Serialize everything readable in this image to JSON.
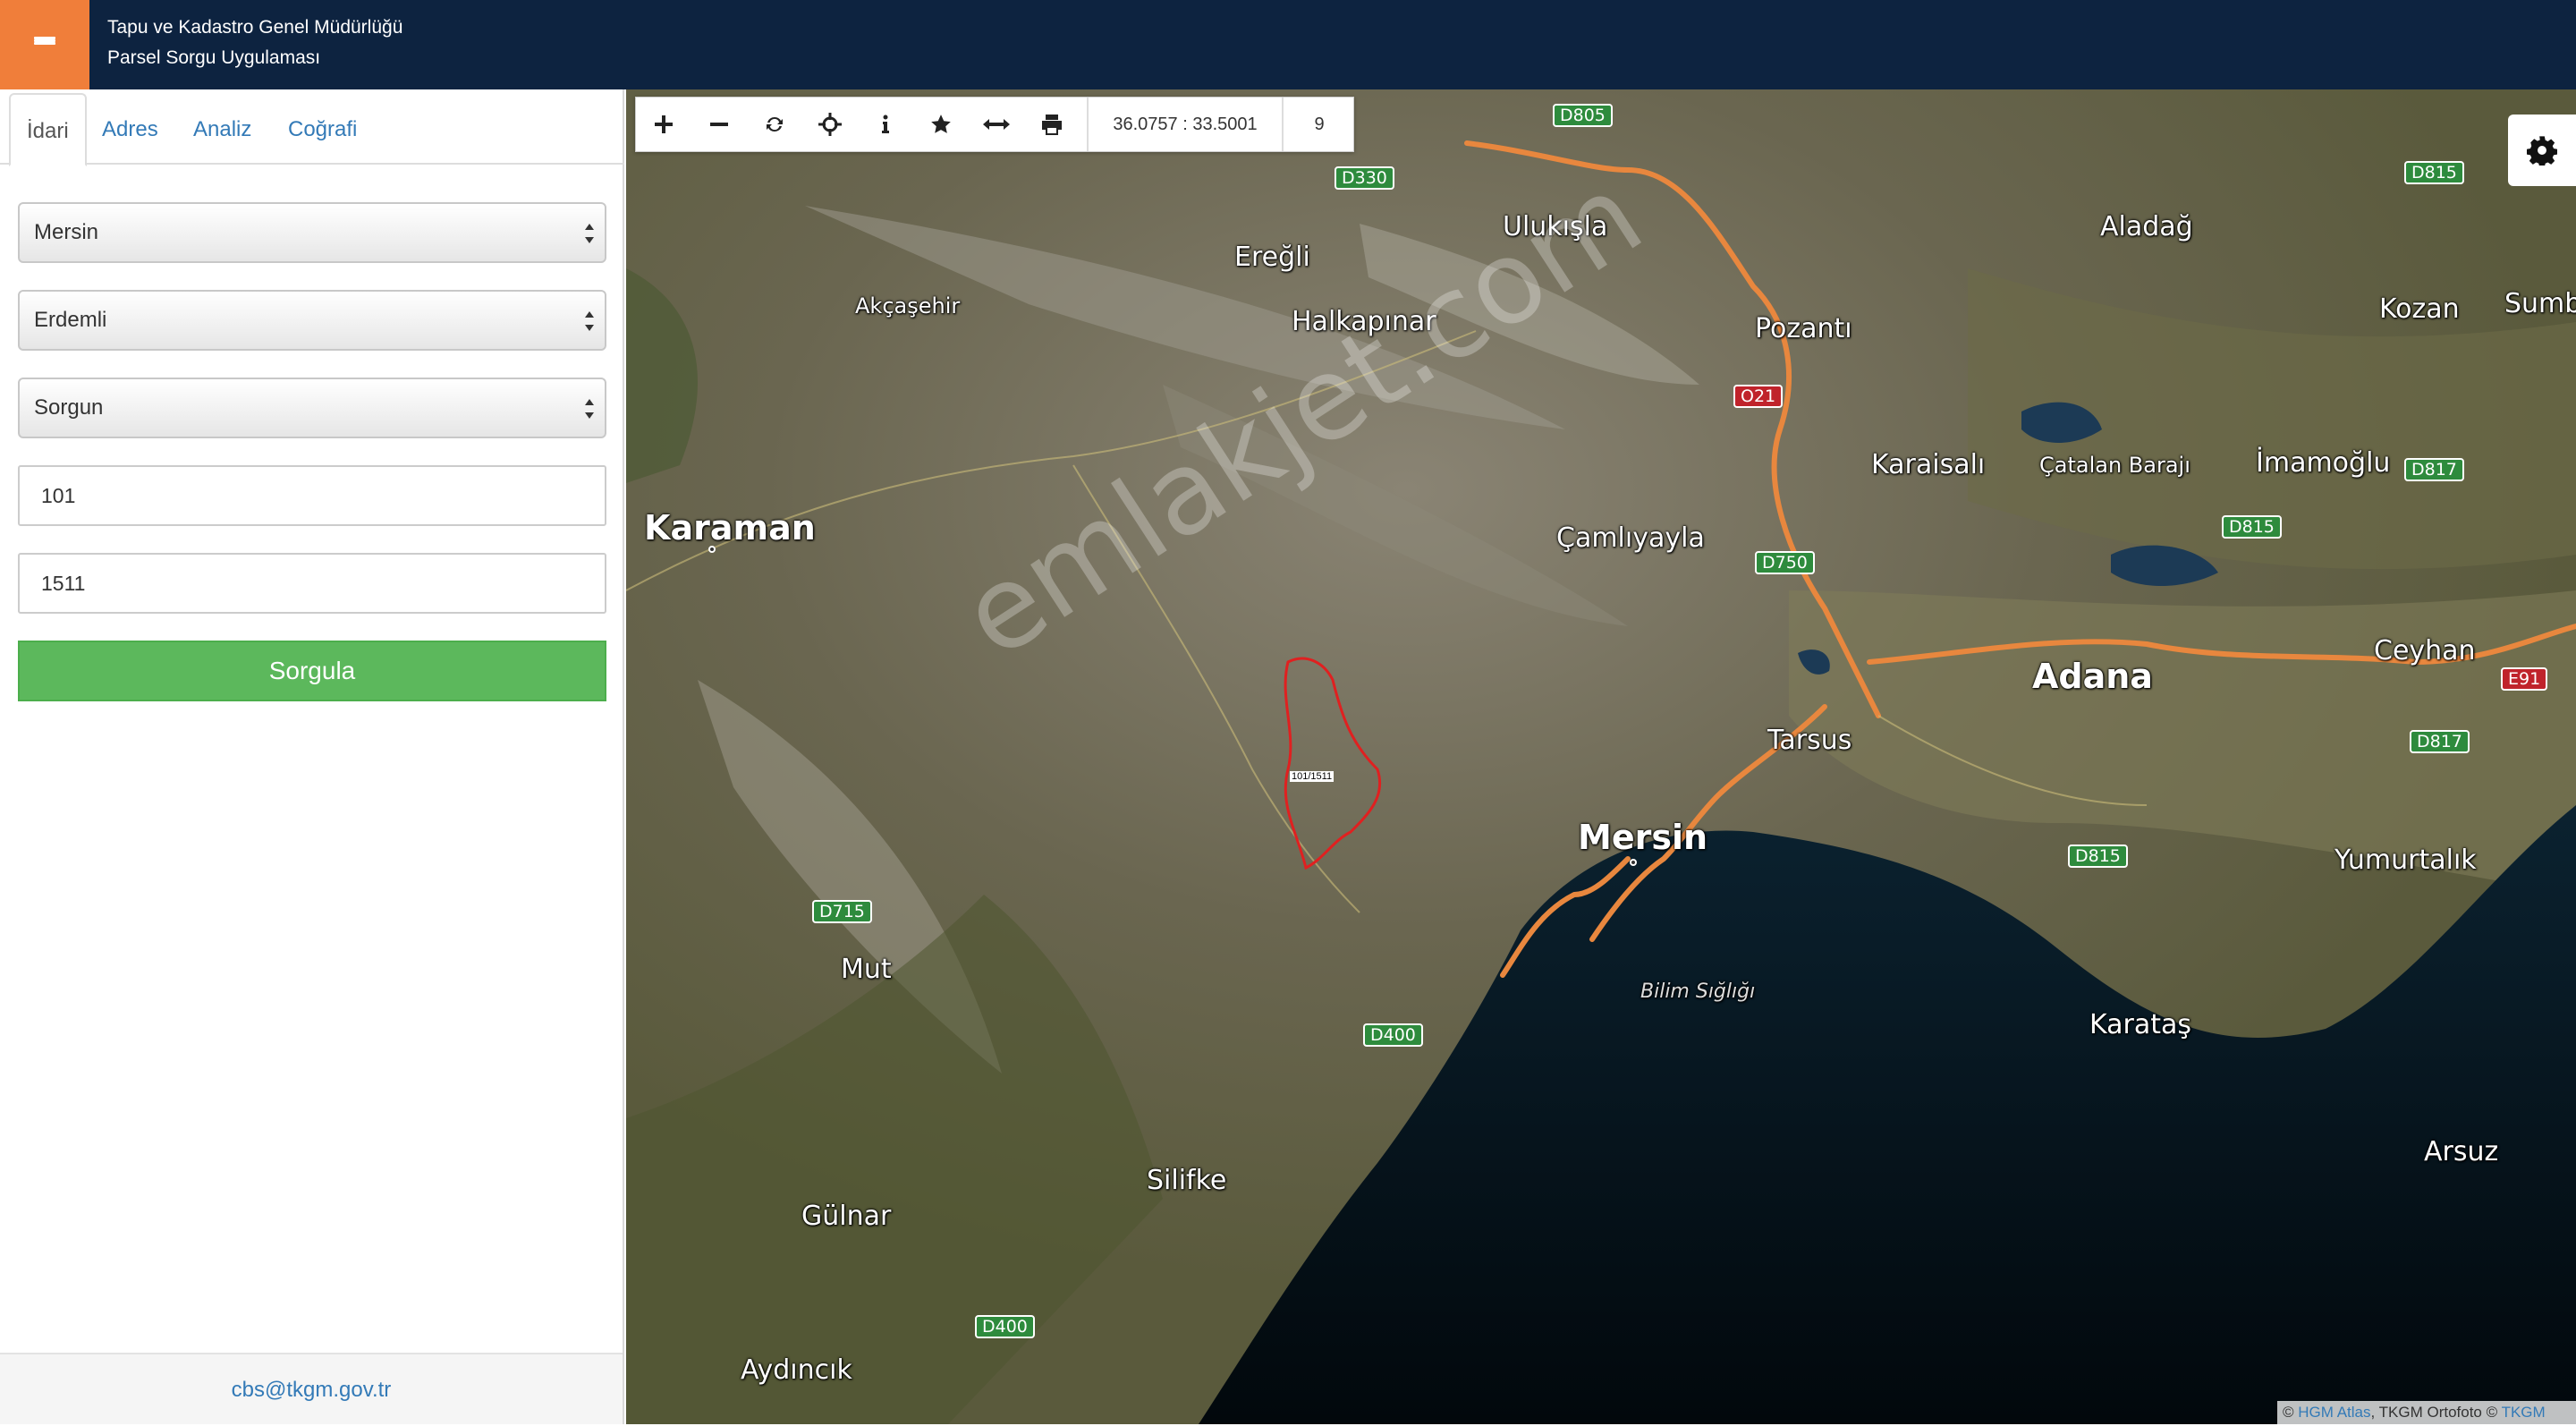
{
  "header": {
    "menu_icon": "hamburger-icon",
    "title_line1": "Tapu ve Kadastro Genel Müdürlüğü",
    "title_line2": "Parsel Sorgu Uygulaması",
    "menu_color": "#f07e3a",
    "bg_color": "#0d2340"
  },
  "tabs": [
    {
      "label": "İdari",
      "active": true
    },
    {
      "label": "Adres",
      "active": false
    },
    {
      "label": "Analiz",
      "active": false
    },
    {
      "label": "Coğrafi",
      "active": false
    }
  ],
  "form": {
    "province": "Mersin",
    "district": "Erdemli",
    "neighborhood": "Sorgun",
    "block": "101",
    "parcel": "1511",
    "submit_label": "Sorgula",
    "submit_color": "#5cb85c"
  },
  "footer": {
    "email": "cbs@tkgm.gov.tr"
  },
  "toolbar": {
    "icons": [
      "plus-icon",
      "minus-icon",
      "refresh-icon",
      "crosshair-icon",
      "info-icon",
      "star-icon",
      "measure-icon",
      "print-icon"
    ],
    "coordinates": "36.0757 : 33.5001",
    "zoom_level": "9"
  },
  "settings_icon": "gear-icon",
  "attribution": {
    "prefix": "© ",
    "hgm": "HGM Atlas",
    "middle": ", TKGM Ortofoto © ",
    "tkgm": "TKGM"
  },
  "watermark": "emlakjet.com",
  "parcel_label": "101/1511",
  "map": {
    "places": [
      {
        "name": "Karaman",
        "size": "lg"
      },
      {
        "name": "Akçaşehir",
        "size": "sm"
      },
      {
        "name": "Ereğli",
        "size": "md"
      },
      {
        "name": "Ulukışla",
        "size": "md"
      },
      {
        "name": "Halkapınar",
        "size": "md"
      },
      {
        "name": "Pozantı",
        "size": "md"
      },
      {
        "name": "Aladağ",
        "size": "md"
      },
      {
        "name": "Kozan",
        "size": "md"
      },
      {
        "name": "Sumba",
        "size": "md"
      },
      {
        "name": "Karaisalı",
        "size": "md"
      },
      {
        "name": "Çatalan Barajı",
        "size": "sm"
      },
      {
        "name": "İmamoğlu",
        "size": "md"
      },
      {
        "name": "Çamlıyayla",
        "size": "md"
      },
      {
        "name": "Adana",
        "size": "lg"
      },
      {
        "name": "Ceyhan",
        "size": "md"
      },
      {
        "name": "Tarsus",
        "size": "md"
      },
      {
        "name": "Mersin",
        "size": "lg"
      },
      {
        "name": "Yumurtalık",
        "size": "md"
      },
      {
        "name": "Mut",
        "size": "md"
      },
      {
        "name": "Bilim Sığlığı",
        "size": "sea"
      },
      {
        "name": "Karataş",
        "size": "md"
      },
      {
        "name": "Silifke",
        "size": "md"
      },
      {
        "name": "Gülnar",
        "size": "md"
      },
      {
        "name": "Arsuz",
        "size": "md"
      },
      {
        "name": "Aydıncık",
        "size": "md"
      }
    ],
    "shields": [
      {
        "label": "D805",
        "color": "green"
      },
      {
        "label": "D330",
        "color": "green"
      },
      {
        "label": "D815",
        "color": "green"
      },
      {
        "label": "O21",
        "color": "red"
      },
      {
        "label": "D817",
        "color": "green"
      },
      {
        "label": "D815",
        "color": "green"
      },
      {
        "label": "D750",
        "color": "green"
      },
      {
        "label": "E91",
        "color": "red"
      },
      {
        "label": "D817",
        "color": "green"
      },
      {
        "label": "D815",
        "color": "green"
      },
      {
        "label": "D715",
        "color": "green"
      },
      {
        "label": "D400",
        "color": "green"
      },
      {
        "label": "D400",
        "color": "green"
      }
    ]
  }
}
